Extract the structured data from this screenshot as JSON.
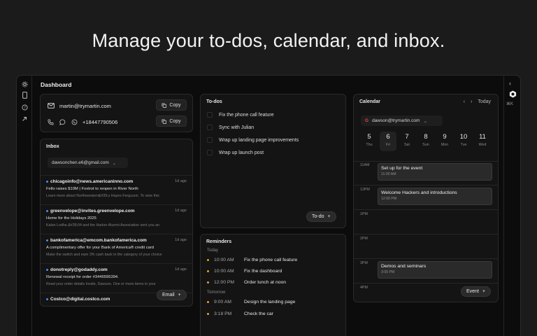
{
  "hero": "Manage your to-dos, calendar, and inbox.",
  "dashboard": {
    "title": "Dashboard"
  },
  "contact": {
    "email": "martin@trymartin.com",
    "phone": "+18447790506",
    "copy_label": "Copy"
  },
  "inbox": {
    "title": "Inbox",
    "account": "dawsonchen.e6@gmail.com",
    "compose_label": "Email",
    "messages": [
      {
        "from": "chicagoinfo@news.americaninno.com",
        "date": "1d ago",
        "subject": "Fello raises $10M | Foxtrot to reopen in River North",
        "snippet": "Learn more about Northwestern&#39;s Hayes Ferguson. To view this"
      },
      {
        "from": "greenvelope@invites.greenvelope.com",
        "date": "1d ago",
        "subject": "Home for the Holidays 2025",
        "snippet": "Kalan Lodha &#39;04 and the Harker Alumni Association sent you an"
      },
      {
        "from": "bankofamerica@emcom.bankofamerica.com",
        "date": "1d ago",
        "subject": "A complimentary offer for your Bank of America® credit card",
        "snippet": "Make the switch and earn 3% cash back in the category of your choice"
      },
      {
        "from": "donotreply@godaddy.com",
        "date": "1d ago",
        "subject": "Renewal receipt for order #3446595394.",
        "snippet": "Read your order details Inside, Dawson. One or more items in your"
      },
      {
        "from": "Costco@digital.costco.com",
        "date": "",
        "subject": "",
        "snippet": ""
      }
    ]
  },
  "todos": {
    "title": "To-dos",
    "add_label": "To-do",
    "items": [
      "Fix the phone call feature",
      "Sync with Julian",
      "Wrap up landing page improvements",
      "Wrap up launch post"
    ]
  },
  "reminders": {
    "title": "Reminders",
    "groups": [
      {
        "label": "Today",
        "items": [
          {
            "time": "10:00 AM",
            "text": "Fix the phone call feature"
          },
          {
            "time": "10:00 AM",
            "text": "Fix the dashboard"
          },
          {
            "time": "12:00 PM",
            "text": "Order lunch at noon"
          }
        ]
      },
      {
        "label": "Tomorrow",
        "items": [
          {
            "time": "9:00 AM",
            "text": "Design the landing page"
          },
          {
            "time": "3:18 PM",
            "text": "Check the car"
          }
        ]
      }
    ]
  },
  "calendar": {
    "title": "Calendar",
    "today_label": "Today",
    "account": "dawson@trymartin.com",
    "add_label": "Event",
    "days": [
      {
        "n": "5",
        "w": "Thu"
      },
      {
        "n": "6",
        "w": "Fri"
      },
      {
        "n": "7",
        "w": "Sat"
      },
      {
        "n": "8",
        "w": "Sun"
      },
      {
        "n": "9",
        "w": "Mon"
      },
      {
        "n": "10",
        "w": "Tue"
      },
      {
        "n": "11",
        "w": "Wed"
      }
    ],
    "hours": [
      "11AM",
      "12PM",
      "1PM",
      "2PM",
      "3PM",
      "4PM"
    ],
    "events": [
      {
        "title": "Set up for the event",
        "time": "11:00 AM"
      },
      {
        "title": "Welcome Hackers and introductions",
        "time": "12:00 PM"
      },
      {
        "title": "Demos and seminars",
        "time": "3:00 PM"
      }
    ]
  },
  "side": {
    "shortcut": "⌘K"
  },
  "colors": {
    "bg": "#1b1b1b",
    "panel": "#141414",
    "unread_dot": "#4a8ef0",
    "reminder_dot": "#e0a035"
  }
}
